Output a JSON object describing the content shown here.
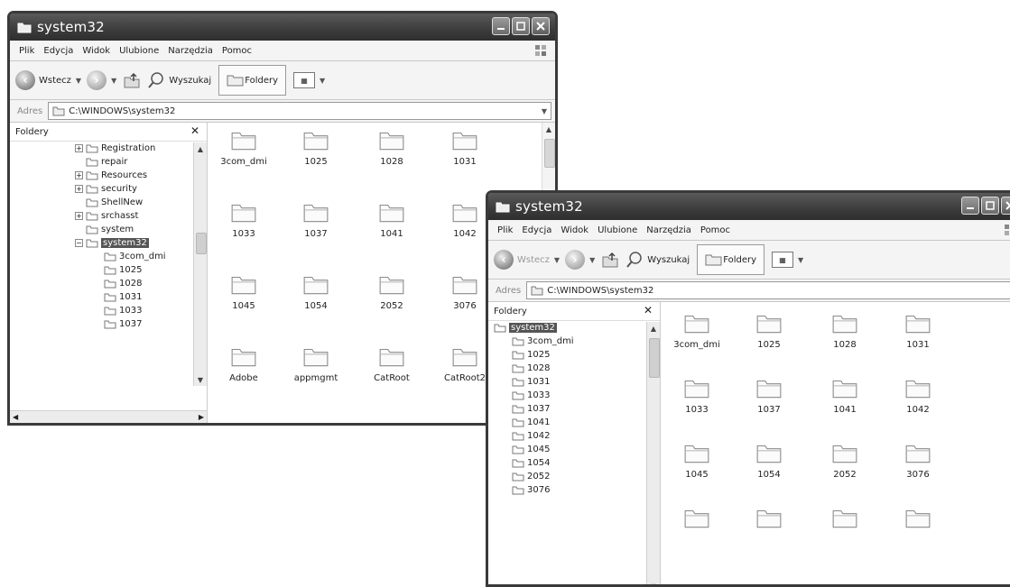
{
  "window1": {
    "title": "system32",
    "menu": [
      "Plik",
      "Edycja",
      "Widok",
      "Ulubione",
      "Narzędzia",
      "Pomoc"
    ],
    "toolbar": {
      "back_label": "Wstecz",
      "search_label": "Wyszukaj",
      "folders_label": "Foldery"
    },
    "address": {
      "label": "Adres",
      "value": "C:\\WINDOWS\\system32"
    },
    "folders_pane": {
      "title": "Foldery",
      "tree": [
        {
          "label": "Registration",
          "expander": "+"
        },
        {
          "label": "repair",
          "expander": ""
        },
        {
          "label": "Resources",
          "expander": "+"
        },
        {
          "label": "security",
          "expander": "+"
        },
        {
          "label": "ShellNew",
          "expander": ""
        },
        {
          "label": "srchasst",
          "expander": "+"
        },
        {
          "label": "system",
          "expander": ""
        },
        {
          "label": "system32",
          "expander": "−"
        },
        {
          "label": "3com_dmi",
          "expander": ""
        },
        {
          "label": "1025",
          "expander": ""
        },
        {
          "label": "1028",
          "expander": ""
        },
        {
          "label": "1031",
          "expander": ""
        },
        {
          "label": "1033",
          "expander": ""
        },
        {
          "label": "1037",
          "expander": ""
        }
      ]
    },
    "files": [
      "3com_dmi",
      "1025",
      "1028",
      "1031",
      "1033",
      "1037",
      "1041",
      "1042",
      "1045",
      "1054",
      "2052",
      "3076",
      "Adobe",
      "appmgmt",
      "CatRoot",
      "CatRoot2"
    ]
  },
  "window2": {
    "title": "system32",
    "menu": [
      "Plik",
      "Edycja",
      "Widok",
      "Ulubione",
      "Narzędzia",
      "Pomoc"
    ],
    "toolbar": {
      "back_label": "Wstecz",
      "search_label": "Wyszukaj",
      "folders_label": "Foldery"
    },
    "address": {
      "label": "Adres",
      "value": "C:\\WINDOWS\\system32"
    },
    "folders_pane": {
      "title": "Foldery",
      "tree": [
        {
          "label": "system32"
        },
        {
          "label": "3com_dmi"
        },
        {
          "label": "1025"
        },
        {
          "label": "1028"
        },
        {
          "label": "1031"
        },
        {
          "label": "1033"
        },
        {
          "label": "1037"
        },
        {
          "label": "1041"
        },
        {
          "label": "1042"
        },
        {
          "label": "1045"
        },
        {
          "label": "1054"
        },
        {
          "label": "2052"
        },
        {
          "label": "3076"
        }
      ]
    },
    "files": [
      "3com_dmi",
      "1025",
      "1028",
      "1031",
      "1033",
      "1037",
      "1041",
      "1042",
      "1045",
      "1054",
      "2052",
      "3076",
      "",
      "",
      "",
      ""
    ]
  }
}
